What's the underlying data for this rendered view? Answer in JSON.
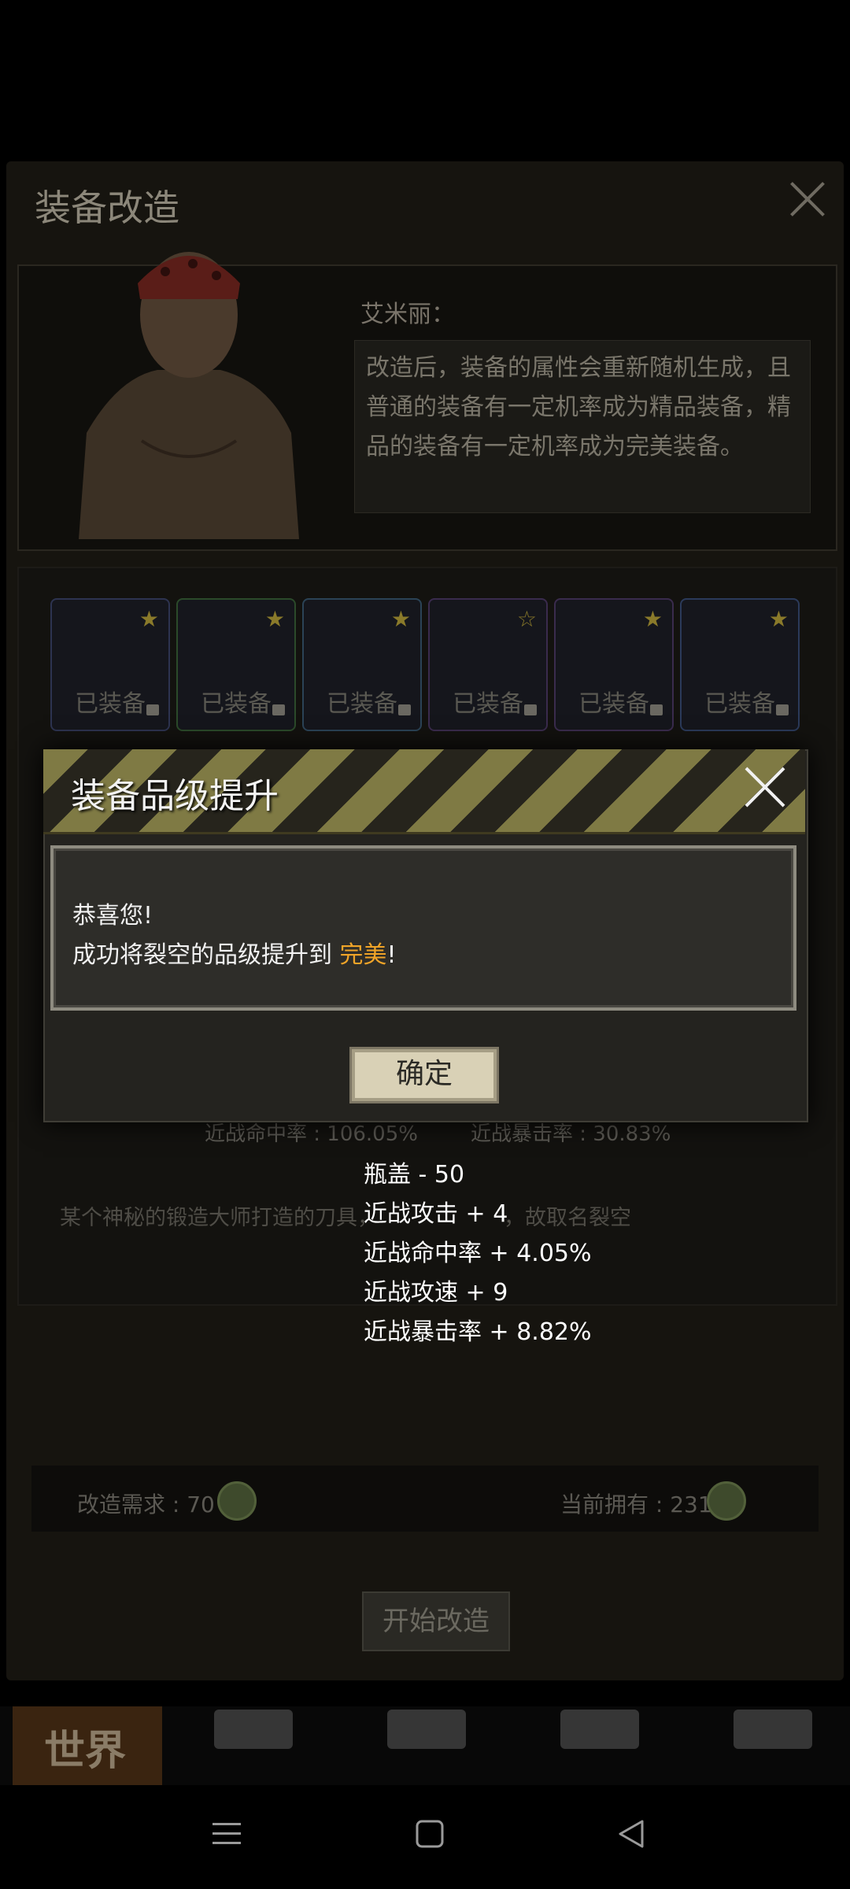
{
  "background_screen": {
    "title": "装备改造",
    "npc": {
      "name": "艾米丽：",
      "dialog": "改造后，装备的属性会重新随机生成，且普通的装备有一定机率成为精品装备，精品的装备有一定机率成为完美装备。"
    },
    "equipment_slots": [
      {
        "label": "已装备"
      },
      {
        "label": "已装备"
      },
      {
        "label": "已装备"
      },
      {
        "label": "已装备"
      },
      {
        "label": "已装备"
      },
      {
        "label": "已装备"
      }
    ],
    "stats_partial": {
      "left": "近战命中率 : 106.05%",
      "right": "近战暴击率 : 30.83%"
    },
    "description": "某个神秘的锻造大师打造的刀具，",
    "description_tail": "，故取名裂空",
    "requirement_label": "改造需求 : 70",
    "owned_label": "当前拥有 : 231",
    "start_button": "开始改造",
    "nav": {
      "world_label": "世界"
    }
  },
  "reward_lines": [
    "瓶盖 - 50",
    "近战攻击 + 4",
    "近战命中率 + 4.05%",
    "近战攻速 + 9",
    "近战暴击率 + 8.82%"
  ],
  "modal": {
    "title": "装备品级提升",
    "line1": "恭喜您!",
    "line2_prefix": "成功将裂空的品级提升到 ",
    "line2_highlight": "完美",
    "line2_suffix": "!",
    "confirm_button": "确定"
  },
  "colors": {
    "highlight": "#f0a428",
    "modal_bg": "#24231f",
    "stripe": "#7f7a44"
  }
}
